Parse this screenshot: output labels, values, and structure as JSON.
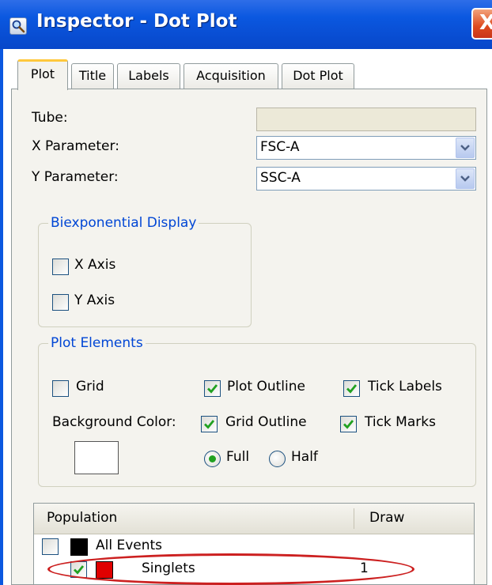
{
  "window": {
    "title": "Inspector - Dot Plot",
    "close_glyph": "X"
  },
  "tabs": [
    {
      "label": "Plot",
      "active": true
    },
    {
      "label": "Title",
      "active": false
    },
    {
      "label": "Labels",
      "active": false
    },
    {
      "label": "Acquisition",
      "active": false
    },
    {
      "label": "Dot Plot",
      "active": false
    }
  ],
  "form": {
    "tube_label": "Tube:",
    "tube_value": "",
    "x_param_label": "X Parameter:",
    "x_param_value": "FSC-A",
    "y_param_label": "Y Parameter:",
    "y_param_value": "SSC-A"
  },
  "biexponential": {
    "legend": "Biexponential Display",
    "x_axis": {
      "label": "X Axis",
      "checked": false
    },
    "y_axis": {
      "label": "Y Axis",
      "checked": false
    }
  },
  "plot_elements": {
    "legend": "Plot Elements",
    "grid": {
      "label": "Grid",
      "checked": false
    },
    "plot_outline": {
      "label": "Plot Outline",
      "checked": true
    },
    "tick_labels": {
      "label": "Tick Labels",
      "checked": true
    },
    "background_color_label": "Background Color:",
    "background_color": "#ffffff",
    "grid_outline": {
      "label": "Grid Outline",
      "checked": true
    },
    "tick_marks": {
      "label": "Tick Marks",
      "checked": true
    },
    "full": {
      "label": "Full",
      "selected": true
    },
    "half": {
      "label": "Half",
      "selected": false
    }
  },
  "population_table": {
    "col_population": "Population",
    "col_draw": "Draw",
    "rows": [
      {
        "name": "All Events",
        "checked": false,
        "color": "#000000",
        "draw": ""
      },
      {
        "name": "Singlets",
        "checked": true,
        "color": "#e00000",
        "draw": "1"
      }
    ]
  },
  "colors": {
    "title_bar": "#0b58e0",
    "accent_tab": "#ffc83c",
    "group_legend": "#0046d5",
    "check": "#21a121",
    "highlight": "#cc2020"
  }
}
